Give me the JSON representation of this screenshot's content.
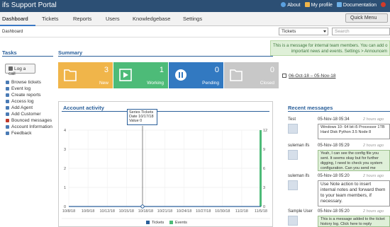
{
  "header": {
    "title": "ifs Support Portal",
    "links": [
      {
        "label": "About",
        "icon": "info-icon"
      },
      {
        "label": "My profile",
        "icon": "user-icon"
      },
      {
        "label": "Documentation",
        "icon": "book-icon"
      },
      {
        "label": "",
        "icon": "logout-icon"
      }
    ]
  },
  "nav": {
    "tabs": [
      "Dashboard",
      "Tickets",
      "Reports",
      "Users",
      "Knowledgebase",
      "Settings"
    ],
    "active_tab": "Dashboard",
    "quick_menu": "Quick Menu"
  },
  "subbar": {
    "breadcrumb": "Dashboard",
    "search_scope": "Tickets",
    "search_placeholder": "Search"
  },
  "tasks": {
    "title": "Tasks",
    "log_call": "Log a call",
    "items": [
      "Browse tickets",
      "Event log",
      "Create reports",
      "Access log",
      "Add Agent",
      "Add Customer",
      "Bounced messages",
      "Account Information",
      "Feedback"
    ]
  },
  "summary": {
    "title": "Summary",
    "message": "This is a message for internal team members. You can add o",
    "message_line2": "important news and events. Settings > Announcem",
    "date_range": "06-Oct-18 – 05-Nov-18",
    "cards": [
      {
        "count": "3",
        "label": "New",
        "color": "#f0b54a"
      },
      {
        "count": "1",
        "label": "Working",
        "color": "#4dbb78"
      },
      {
        "count": "0",
        "label": "Pending",
        "color": "#3279c1"
      },
      {
        "count": "0",
        "label": "Closed",
        "color": "#c8c8c8"
      }
    ]
  },
  "activity": {
    "title": "Account activity",
    "tooltip": {
      "series": "Series  Tickets",
      "date": "Date  10/17/18",
      "value": "Value  0"
    },
    "legend_tickets": "Tickets",
    "legend_events": "Events"
  },
  "chart_data": {
    "type": "line",
    "x_ticks": [
      "10/8/18",
      "10/9/18",
      "10/12/18",
      "10/15/18",
      "10/18/18",
      "10/21/18",
      "10/24/18",
      "10/27/18",
      "10/30/18",
      "11/2/18",
      "11/5/18"
    ],
    "y_left_ticks": [
      "0",
      "1",
      "2",
      "3",
      "4"
    ],
    "y_right_ticks": [
      "0",
      "3",
      "6",
      "9",
      "12"
    ],
    "ylim_left": [
      0,
      4
    ],
    "ylim_right": [
      0,
      12
    ],
    "grid": true,
    "legend": "bottom",
    "series": [
      {
        "name": "Tickets",
        "color": "#2a5f9a",
        "axis": "left",
        "x_index": [
          0,
          10
        ],
        "values": [
          0,
          0
        ]
      },
      {
        "name": "Events",
        "color": "#4dbb78",
        "axis": "right",
        "bar_at": 10,
        "value": 12
      }
    ]
  },
  "recent": {
    "title": "Recent messages",
    "messages": [
      {
        "who": "Test",
        "date": "05-Nov-18 05:34",
        "ago": "2 hours ago",
        "text": "Windows 10- 64 bit i5 Processor 1TB Hard Disk Python 3.5 Node 8",
        "style": "white"
      },
      {
        "who": "suleman ifs",
        "date": "05-Nov-18 05:29",
        "ago": "2 hours ago",
        "text": "Yeah, I can see the config file you sent. It seems okay but for further digging, I need to check you system configuration. Can you send me",
        "style": "green"
      },
      {
        "who": "suleman ifs",
        "date": "05-Nov-18 05:20",
        "ago": "2 hours ago",
        "text": "Use Note action to insert internal notes and forward them to your team members, if necessary.",
        "style": "white"
      },
      {
        "who": "Sample User",
        "date": "05-Nov-18 05:20",
        "ago": "2 hours ago",
        "text": "This is a message added to the ticket history log. Click here to reply",
        "style": "green"
      }
    ]
  }
}
